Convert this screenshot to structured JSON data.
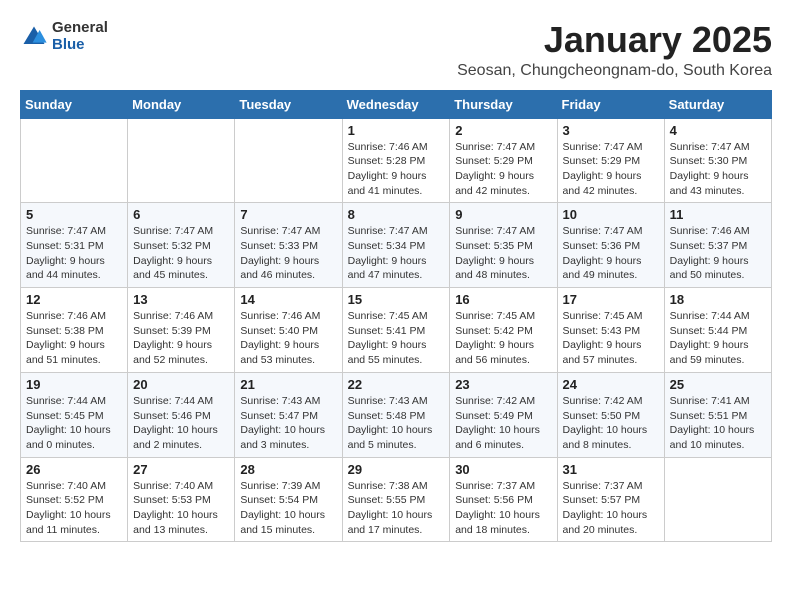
{
  "logo": {
    "text_general": "General",
    "text_blue": "Blue"
  },
  "header": {
    "month_title": "January 2025",
    "subtitle": "Seosan, Chungcheongnam-do, South Korea"
  },
  "weekdays": [
    "Sunday",
    "Monday",
    "Tuesday",
    "Wednesday",
    "Thursday",
    "Friday",
    "Saturday"
  ],
  "weeks": [
    [
      {
        "day": "",
        "info": ""
      },
      {
        "day": "",
        "info": ""
      },
      {
        "day": "",
        "info": ""
      },
      {
        "day": "1",
        "info": "Sunrise: 7:46 AM\nSunset: 5:28 PM\nDaylight: 9 hours\nand 41 minutes."
      },
      {
        "day": "2",
        "info": "Sunrise: 7:47 AM\nSunset: 5:29 PM\nDaylight: 9 hours\nand 42 minutes."
      },
      {
        "day": "3",
        "info": "Sunrise: 7:47 AM\nSunset: 5:29 PM\nDaylight: 9 hours\nand 42 minutes."
      },
      {
        "day": "4",
        "info": "Sunrise: 7:47 AM\nSunset: 5:30 PM\nDaylight: 9 hours\nand 43 minutes."
      }
    ],
    [
      {
        "day": "5",
        "info": "Sunrise: 7:47 AM\nSunset: 5:31 PM\nDaylight: 9 hours\nand 44 minutes."
      },
      {
        "day": "6",
        "info": "Sunrise: 7:47 AM\nSunset: 5:32 PM\nDaylight: 9 hours\nand 45 minutes."
      },
      {
        "day": "7",
        "info": "Sunrise: 7:47 AM\nSunset: 5:33 PM\nDaylight: 9 hours\nand 46 minutes."
      },
      {
        "day": "8",
        "info": "Sunrise: 7:47 AM\nSunset: 5:34 PM\nDaylight: 9 hours\nand 47 minutes."
      },
      {
        "day": "9",
        "info": "Sunrise: 7:47 AM\nSunset: 5:35 PM\nDaylight: 9 hours\nand 48 minutes."
      },
      {
        "day": "10",
        "info": "Sunrise: 7:47 AM\nSunset: 5:36 PM\nDaylight: 9 hours\nand 49 minutes."
      },
      {
        "day": "11",
        "info": "Sunrise: 7:46 AM\nSunset: 5:37 PM\nDaylight: 9 hours\nand 50 minutes."
      }
    ],
    [
      {
        "day": "12",
        "info": "Sunrise: 7:46 AM\nSunset: 5:38 PM\nDaylight: 9 hours\nand 51 minutes."
      },
      {
        "day": "13",
        "info": "Sunrise: 7:46 AM\nSunset: 5:39 PM\nDaylight: 9 hours\nand 52 minutes."
      },
      {
        "day": "14",
        "info": "Sunrise: 7:46 AM\nSunset: 5:40 PM\nDaylight: 9 hours\nand 53 minutes."
      },
      {
        "day": "15",
        "info": "Sunrise: 7:45 AM\nSunset: 5:41 PM\nDaylight: 9 hours\nand 55 minutes."
      },
      {
        "day": "16",
        "info": "Sunrise: 7:45 AM\nSunset: 5:42 PM\nDaylight: 9 hours\nand 56 minutes."
      },
      {
        "day": "17",
        "info": "Sunrise: 7:45 AM\nSunset: 5:43 PM\nDaylight: 9 hours\nand 57 minutes."
      },
      {
        "day": "18",
        "info": "Sunrise: 7:44 AM\nSunset: 5:44 PM\nDaylight: 9 hours\nand 59 minutes."
      }
    ],
    [
      {
        "day": "19",
        "info": "Sunrise: 7:44 AM\nSunset: 5:45 PM\nDaylight: 10 hours\nand 0 minutes."
      },
      {
        "day": "20",
        "info": "Sunrise: 7:44 AM\nSunset: 5:46 PM\nDaylight: 10 hours\nand 2 minutes."
      },
      {
        "day": "21",
        "info": "Sunrise: 7:43 AM\nSunset: 5:47 PM\nDaylight: 10 hours\nand 3 minutes."
      },
      {
        "day": "22",
        "info": "Sunrise: 7:43 AM\nSunset: 5:48 PM\nDaylight: 10 hours\nand 5 minutes."
      },
      {
        "day": "23",
        "info": "Sunrise: 7:42 AM\nSunset: 5:49 PM\nDaylight: 10 hours\nand 6 minutes."
      },
      {
        "day": "24",
        "info": "Sunrise: 7:42 AM\nSunset: 5:50 PM\nDaylight: 10 hours\nand 8 minutes."
      },
      {
        "day": "25",
        "info": "Sunrise: 7:41 AM\nSunset: 5:51 PM\nDaylight: 10 hours\nand 10 minutes."
      }
    ],
    [
      {
        "day": "26",
        "info": "Sunrise: 7:40 AM\nSunset: 5:52 PM\nDaylight: 10 hours\nand 11 minutes."
      },
      {
        "day": "27",
        "info": "Sunrise: 7:40 AM\nSunset: 5:53 PM\nDaylight: 10 hours\nand 13 minutes."
      },
      {
        "day": "28",
        "info": "Sunrise: 7:39 AM\nSunset: 5:54 PM\nDaylight: 10 hours\nand 15 minutes."
      },
      {
        "day": "29",
        "info": "Sunrise: 7:38 AM\nSunset: 5:55 PM\nDaylight: 10 hours\nand 17 minutes."
      },
      {
        "day": "30",
        "info": "Sunrise: 7:37 AM\nSunset: 5:56 PM\nDaylight: 10 hours\nand 18 minutes."
      },
      {
        "day": "31",
        "info": "Sunrise: 7:37 AM\nSunset: 5:57 PM\nDaylight: 10 hours\nand 20 minutes."
      },
      {
        "day": "",
        "info": ""
      }
    ]
  ]
}
